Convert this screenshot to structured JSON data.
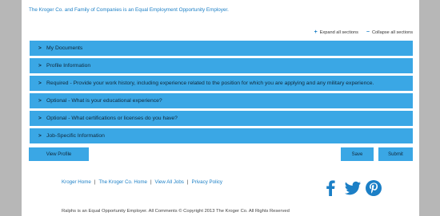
{
  "header": {
    "eeo_text": "The Kroger Co. and Family of Companies is an Equal Employment Opportunity Employer."
  },
  "controls": {
    "expand_label": "Expand all sections",
    "collapse_label": "Collapse all sections"
  },
  "accordion": {
    "sections": [
      {
        "label": "My Documents"
      },
      {
        "label": "Profile Information"
      },
      {
        "label": "Required - Provide your work history, including experience related to the position for which you are applying and any military experience."
      },
      {
        "label": "Optional - What is your educational experience?"
      },
      {
        "label": "Optional - What certifications or licenses do you have?"
      },
      {
        "label": "Job-Specific Information"
      }
    ]
  },
  "buttons": {
    "view_profile": "View Profile",
    "save": "Save",
    "submit": "Submit"
  },
  "footer": {
    "links": [
      "Kroger Home",
      "The Kroger Co. Home",
      "View All Jobs",
      "Privacy Policy"
    ],
    "social_icons": [
      "facebook-icon",
      "twitter-icon",
      "pinterest-icon"
    ],
    "copyright": "Ralphs is an Equal Opportunity Employer. All Comments © Copyright 2013 The Kroger Co. All Rights Reserved"
  },
  "colors": {
    "accent": "#3aa7e5",
    "link": "#1b7fc6",
    "background": "#b7b7b7"
  }
}
